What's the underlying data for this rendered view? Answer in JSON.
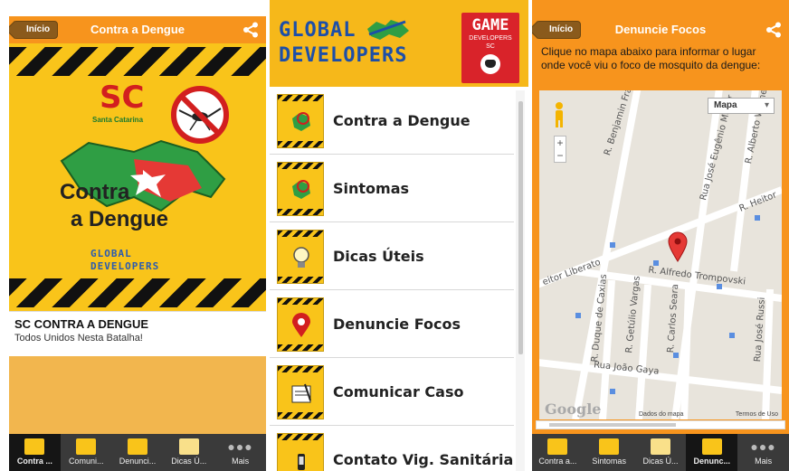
{
  "panel1": {
    "header": {
      "back_label": "Início",
      "title": "Contra a Dengue"
    },
    "splash": {
      "state_abbr": "SC",
      "state_name": "Santa Catarina",
      "title_line1": "Contra",
      "title_line2": "a Dengue",
      "logo_line1": "GLOBAL",
      "logo_line2": "DEVELOPERS"
    },
    "caption": {
      "title": "SC CONTRA A DENGUE",
      "subtitle": "Todos Unidos Nesta Batalha!"
    },
    "tabs": [
      {
        "label": "Contra ...",
        "icon": "dengue-icon",
        "active": true
      },
      {
        "label": "Comuni...",
        "icon": "notify-icon",
        "active": false
      },
      {
        "label": "Denunci...",
        "icon": "pin-icon",
        "active": false
      },
      {
        "label": "Dicas Ú...",
        "icon": "bulb-icon",
        "active": false
      },
      {
        "label": "Mais",
        "icon": "more-icon",
        "active": false
      }
    ]
  },
  "panel2": {
    "logo_line1": "GLOBAL",
    "logo_line2": "DEVELOPERS",
    "game_logo": {
      "word": "GAME",
      "sub1": "DEVELOPERS",
      "sub2": "SC"
    },
    "menu": [
      {
        "label": "Contra a Dengue",
        "icon": "dengue-thumb-icon"
      },
      {
        "label": "Sintomas",
        "icon": "dengue-thumb-icon"
      },
      {
        "label": "Dicas Úteis",
        "icon": "bulb-thumb-icon"
      },
      {
        "label": "Denuncie Focos",
        "icon": "pin-thumb-icon"
      },
      {
        "label": "Comunicar Caso",
        "icon": "notify-thumb-icon"
      },
      {
        "label": "Contato Vig. Sanitária",
        "icon": "phone-thumb-icon"
      }
    ]
  },
  "panel3": {
    "header": {
      "back_label": "Início",
      "title": "Denuncie Focos"
    },
    "instructions": "Clique no mapa abaixo para informar o lugar onde você viu o foco de mosquito da dengue:",
    "map": {
      "type_selector": "Mapa",
      "streets": [
        "R. Benjamin Franklin Pereira",
        "Rua José Eugênio Müller",
        "R. Alberto Werner",
        "R. Heitor",
        "eitor Liberato",
        "R. Alfredo Trompovski",
        "R. Duque de Caxias",
        "R. Getúlio Vargas",
        "R. Carlos Seara",
        "Rua João Gaya",
        "Rua José Russi"
      ],
      "provider": "Google",
      "map_data": "Dados do mapa",
      "terms": "Termos de Uso"
    },
    "tabs": [
      {
        "label": "Contra a...",
        "icon": "dengue-icon",
        "active": false
      },
      {
        "label": "Sintomas",
        "icon": "dengue-icon",
        "active": false
      },
      {
        "label": "Dicas Ú...",
        "icon": "bulb-icon",
        "active": false
      },
      {
        "label": "Denunc...",
        "icon": "pin-icon",
        "active": true
      },
      {
        "label": "Mais",
        "icon": "more-icon",
        "active": false
      }
    ]
  },
  "colors": {
    "orange": "#f7941d",
    "yellow": "#f9c41a",
    "red": "#d21f1f",
    "blue": "#1d4fa8",
    "tabbar": "#3a3a3a"
  }
}
